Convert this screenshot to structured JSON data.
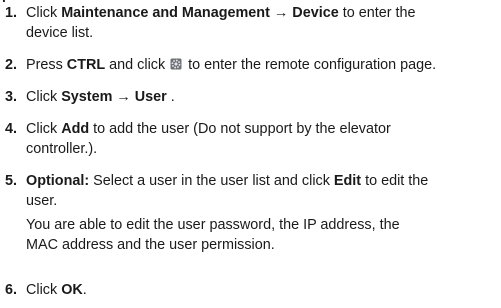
{
  "top_sliver": "p",
  "steps": [
    {
      "num": "1.",
      "pre1": "Click ",
      "bold1": "Maintenance and Management",
      "arrow": " → ",
      "bold2": "Device",
      "post1": " to enter the",
      "line2": "device list."
    },
    {
      "num": "2.",
      "pre1": "Press ",
      "bold1": "CTRL",
      "mid": " and click ",
      "post1": " to enter the remote configuration page.",
      "icon": "gear-icon"
    },
    {
      "num": "3.",
      "pre1": "Click ",
      "bold1": "System",
      "arrow": " → ",
      "bold2": "User",
      "post1": " ."
    },
    {
      "num": "4.",
      "pre1": "Click ",
      "bold1": "Add",
      "post1": " to add the user (Do not support by the elevator",
      "line2": "controller.)."
    },
    {
      "num": "5.",
      "bold0": "Optional:",
      "pre1": " Select a user in the user list and click ",
      "bold1": "Edit",
      "post1": " to edit the",
      "line2": "user.",
      "note_line1": "You are able to edit the user password, the IP address, the",
      "note_line2": "MAC address and the user permission."
    },
    {
      "num": "6.",
      "pre1": "Click ",
      "bold1": "OK",
      "post1": "."
    }
  ]
}
